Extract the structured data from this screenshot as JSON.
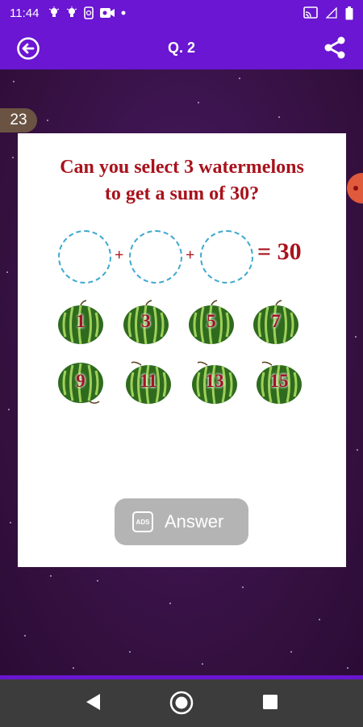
{
  "status_bar": {
    "time": "11:44",
    "icons": [
      "lightbulb-icon",
      "lightbulb-icon",
      "phone-sync-icon",
      "video-icon",
      "dot-icon",
      "cast-icon",
      "signal-icon",
      "battery-icon"
    ]
  },
  "app_bar": {
    "title": "Q. 2",
    "back_icon": "back-arrow-circle-icon",
    "share_icon": "share-icon"
  },
  "level_badge": "23",
  "puzzle": {
    "question_line1": "Can you select 3 watermelons",
    "question_line2": "to get a sum of 30?",
    "plus_1": "+",
    "plus_2": "+",
    "result": "= 30",
    "melons": [
      "1",
      "3",
      "5",
      "7",
      "9",
      "11",
      "13",
      "15"
    ]
  },
  "answer_button": {
    "label": "Answer",
    "icon_text": "ADS"
  },
  "nav_bar": {
    "icons": [
      "back-triangle-icon",
      "home-circle-icon",
      "recents-square-icon"
    ]
  },
  "colors": {
    "primary": "#6a16d2",
    "question_red": "#a8121c",
    "circle_blue": "#3fa9d0",
    "answer_gray": "#b4b4b4"
  }
}
